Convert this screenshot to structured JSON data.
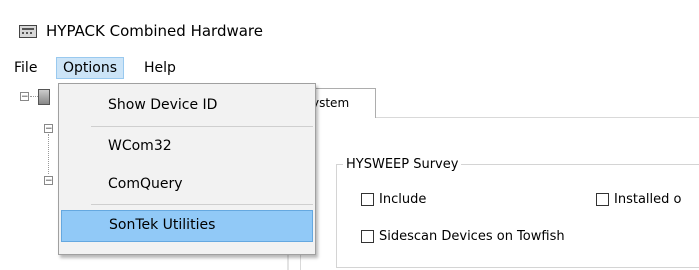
{
  "window": {
    "title": "HYPACK Combined Hardware",
    "icon": "app-hardware-icon"
  },
  "menubar": {
    "items": [
      "File",
      "Options",
      "Help"
    ],
    "active": "Options"
  },
  "options_menu": {
    "items": [
      {
        "label": "Show Device ID"
      },
      {
        "label": "WCom32"
      },
      {
        "label": "ComQuery"
      },
      {
        "label": "SonTek Utilities",
        "highlighted": true
      }
    ]
  },
  "tab": {
    "label": "ystem"
  },
  "group": {
    "title": "HYSWEEP Survey",
    "checkboxes": [
      {
        "label": "Include",
        "checked": false
      },
      {
        "label": "Installed o",
        "checked": false
      },
      {
        "label": "Sidescan Devices on Towfish",
        "checked": false
      }
    ]
  },
  "colors": {
    "highlight": "#91c9f7",
    "menu_bg": "#f2f2f2",
    "active_menu_bg": "#cce4f7"
  }
}
